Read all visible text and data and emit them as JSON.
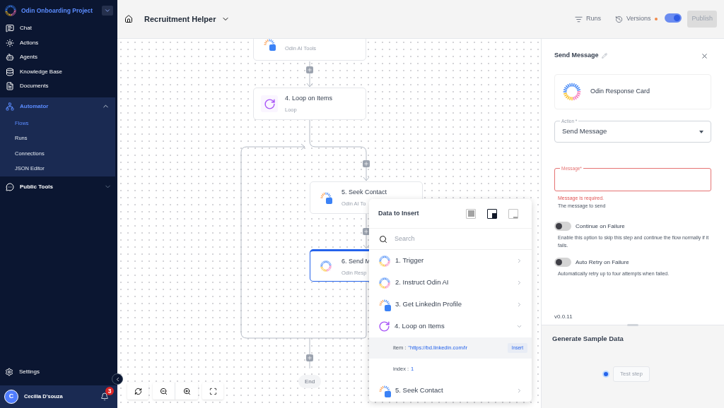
{
  "sidebar": {
    "project": "Odin Onboarding Project",
    "items": [
      {
        "label": "Chat"
      },
      {
        "label": "Actions"
      },
      {
        "label": "Agents"
      },
      {
        "label": "Knowledge Base"
      },
      {
        "label": "Documents"
      }
    ],
    "groups": [
      {
        "label": "Automator",
        "expanded": true,
        "children": [
          {
            "label": "Flows",
            "selected": true
          },
          {
            "label": "Runs",
            "selected": false
          },
          {
            "label": "Connections",
            "selected": false
          },
          {
            "label": "JSON Editor",
            "selected": false
          }
        ]
      },
      {
        "label": "Public Tools",
        "expanded": false
      }
    ],
    "settings": "Settings",
    "user": {
      "name": "Cecilia D'souza",
      "initial": "C",
      "notifications": "3"
    }
  },
  "toolbar": {
    "title": "Recruitment Helper",
    "runs": "Runs",
    "versions": "Versions",
    "live": true,
    "publish": "Publish"
  },
  "canvas": {
    "nodes": [
      {
        "subtitle": "Odin AI Tools",
        "kind": "ai",
        "selected": false
      },
      {
        "title": "4. Loop on Items",
        "subtitle": "Loop",
        "kind": "loop",
        "selected": false
      },
      {
        "title": "5. Seek Contact",
        "subtitle": "Odin AI To",
        "kind": "ai",
        "selected": false
      },
      {
        "title": "6. Send M",
        "subtitle": "Odin Resp",
        "kind": "odin",
        "selected": true
      }
    ],
    "end": "End"
  },
  "data_popup": {
    "title": "Data to Insert",
    "layouts": [
      {
        "selected": false
      },
      {
        "selected": true
      },
      {
        "selected": false
      }
    ],
    "search_placeholder": "Search",
    "steps": [
      {
        "label": "1. Trigger",
        "kind": "odin",
        "expanded": false
      },
      {
        "label": "2. Instruct Odin AI",
        "kind": "odin",
        "expanded": false
      },
      {
        "label": "3. Get LinkedIn Profile",
        "kind": "ai",
        "expanded": false
      },
      {
        "label": "4. Loop on Items",
        "kind": "loop",
        "expanded": true,
        "fields": [
          {
            "key": "item :",
            "value": "\"https://bd.linkedin.com/ir",
            "highlighted": true,
            "action": "Insert"
          },
          {
            "key": "index :",
            "value": "1",
            "highlighted": false
          }
        ]
      },
      {
        "label": "5. Seek Contact",
        "kind": "ai",
        "expanded": false
      }
    ]
  },
  "panel": {
    "title": "Send Message",
    "card": "Odin Response Card",
    "action": {
      "label": "Action *",
      "value": "Send Message"
    },
    "message": {
      "label": "Message*",
      "error": "Message is required.",
      "help": "The message to send",
      "invalid": true
    },
    "toggles": [
      {
        "label": "Continue on Failure",
        "on": false,
        "description": "Enable this option to skip this step and continue the flow normally if it fails."
      },
      {
        "label": "Auto Retry on Failure",
        "on": false,
        "description": "Automatically retry up to four attempts when failed."
      }
    ],
    "version": "v0.0.11"
  },
  "sample": {
    "title": "Generate Sample Data",
    "button": "Test step"
  }
}
